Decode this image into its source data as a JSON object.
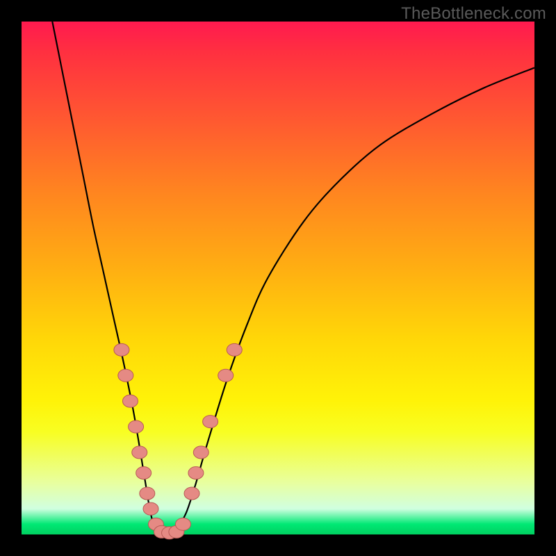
{
  "watermark": "TheBottleneck.com",
  "colors": {
    "frame": "#000000",
    "curve": "#000000",
    "marker_fill": "#e58a84",
    "marker_stroke": "#b85a55",
    "gradient_top": "#ff1a4f",
    "gradient_bottom": "#00d060"
  },
  "chart_data": {
    "type": "line",
    "title": "",
    "xlabel": "",
    "ylabel": "",
    "xlim": [
      0,
      100
    ],
    "ylim": [
      0,
      100
    ],
    "series": [
      {
        "name": "bottleneck-curve",
        "x": [
          6,
          8,
          10,
          12,
          14,
          16,
          18,
          20,
          22,
          24,
          25,
          26,
          27,
          28,
          30,
          32,
          34,
          36,
          40,
          44,
          48,
          55,
          62,
          70,
          80,
          90,
          100
        ],
        "y": [
          100,
          90,
          80,
          70,
          60,
          51,
          42,
          33,
          23,
          11,
          5,
          1,
          0,
          0,
          1,
          4,
          10,
          17,
          30,
          41,
          50,
          61,
          69,
          76,
          82,
          87,
          91
        ]
      }
    ],
    "markers": {
      "name": "highlighted-points",
      "points": [
        {
          "x": 19.5,
          "y": 36
        },
        {
          "x": 20.3,
          "y": 31
        },
        {
          "x": 21.2,
          "y": 26
        },
        {
          "x": 22.3,
          "y": 21
        },
        {
          "x": 23.0,
          "y": 16
        },
        {
          "x": 23.8,
          "y": 12
        },
        {
          "x": 24.5,
          "y": 8
        },
        {
          "x": 25.2,
          "y": 5
        },
        {
          "x": 26.2,
          "y": 2
        },
        {
          "x": 27.3,
          "y": 0.5
        },
        {
          "x": 28.8,
          "y": 0.3
        },
        {
          "x": 30.2,
          "y": 0.5
        },
        {
          "x": 31.5,
          "y": 2
        },
        {
          "x": 33.2,
          "y": 8
        },
        {
          "x": 34.0,
          "y": 12
        },
        {
          "x": 35.0,
          "y": 16
        },
        {
          "x": 36.8,
          "y": 22
        },
        {
          "x": 39.8,
          "y": 31
        },
        {
          "x": 41.5,
          "y": 36
        }
      ]
    }
  }
}
